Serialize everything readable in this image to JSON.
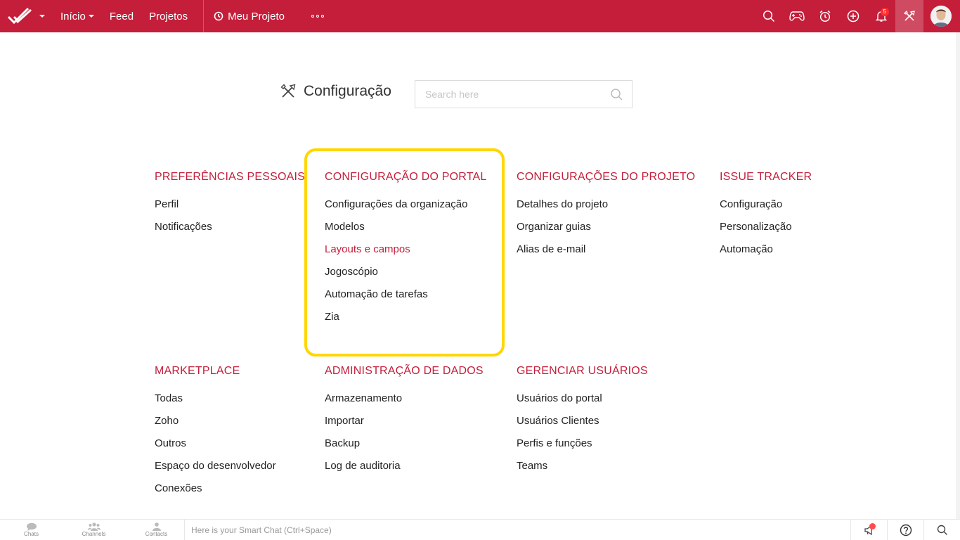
{
  "topbar": {
    "nav": [
      {
        "label": "Início",
        "has_caret": true
      },
      {
        "label": "Feed",
        "has_caret": false
      },
      {
        "label": "Projetos",
        "has_caret": false
      }
    ],
    "project_label": "Meu Projeto",
    "notification_count": "5",
    "icons": [
      "search-icon",
      "gamepad-icon",
      "timer-icon",
      "add-icon",
      "bell-icon",
      "tools-icon"
    ],
    "brand_color": "#c41e3a"
  },
  "page": {
    "title": "Configuração",
    "search_placeholder": "Search here"
  },
  "sections": {
    "personal": {
      "title": "PREFERÊNCIAS PESSOAIS",
      "items": [
        "Perfil",
        "Notificações"
      ]
    },
    "portal": {
      "title": "CONFIGURAÇÃO DO PORTAL",
      "items": [
        "Configurações da organização",
        "Modelos",
        "Layouts e campos",
        "Jogoscópio",
        "Automação de tarefas",
        "Zia"
      ],
      "active_item": "Layouts e campos"
    },
    "project": {
      "title": "CONFIGURAÇÕES DO PROJETO",
      "items": [
        "Detalhes do projeto",
        "Organizar guias",
        "Alias de e-mail"
      ]
    },
    "issue": {
      "title": "ISSUE TRACKER",
      "items": [
        "Configuração",
        "Personalização",
        "Automação"
      ]
    },
    "marketplace": {
      "title": "MARKETPLACE",
      "items": [
        "Todas",
        "Zoho",
        "Outros",
        "Espaço do desenvolvedor",
        "Conexões"
      ]
    },
    "data": {
      "title": "ADMINISTRAÇÃO DE DADOS",
      "items": [
        "Armazenamento",
        "Importar",
        "Backup",
        "Log de auditoria"
      ]
    },
    "users": {
      "title": "GERENCIAR USUÁRIOS",
      "items": [
        "Usuários do portal",
        "Usuários Clientes",
        "Perfis e funções",
        "Teams"
      ]
    }
  },
  "highlight_color": "#ffd700",
  "bottombar": {
    "tabs": [
      "Chats",
      "Channels",
      "Contacts"
    ],
    "smartchat_placeholder": "Here is your Smart Chat (Ctrl+Space)"
  }
}
